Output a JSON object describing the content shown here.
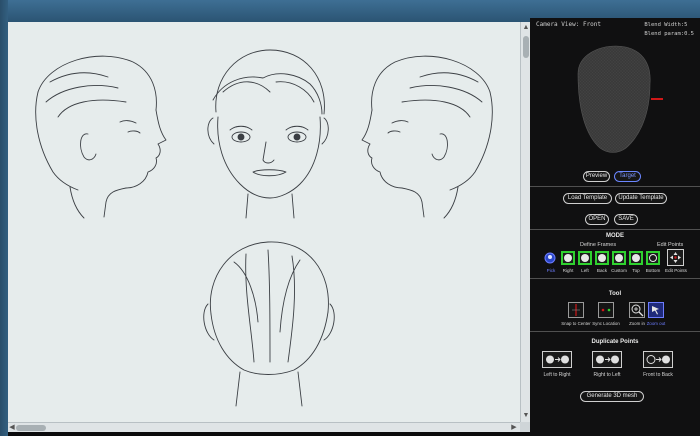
{
  "panel": {
    "camera_view": "Camera View: Front",
    "blend_width": "Blend Width:5",
    "blend_param": "Blend param:0.5",
    "preview_label": "Preview",
    "target_label": "Target",
    "load_template_label": "Load Template",
    "update_template_label": "Update Template",
    "open_label": "OPEN",
    "save_label": "SAVE",
    "mode_title": "MODE",
    "define_frames_label": "Define Frames",
    "edit_points_heading": "Edit Points",
    "mode_items": [
      {
        "label": "Pick",
        "icon": "pick-icon"
      },
      {
        "label": "Right",
        "icon": "head-right-icon"
      },
      {
        "label": "Left",
        "icon": "head-left-icon"
      },
      {
        "label": "Back",
        "icon": "head-back-icon"
      },
      {
        "label": "Custom",
        "icon": "head-custom-icon"
      },
      {
        "label": "Top",
        "icon": "head-top-icon"
      },
      {
        "label": "Bottom",
        "icon": "head-bottom-icon"
      },
      {
        "label": "Edit Points",
        "icon": "edit-points-icon"
      }
    ],
    "tool_title": "Tool",
    "tool_items": [
      {
        "label": "Snap to Center",
        "icon": "snap-to-center-icon"
      },
      {
        "label": "Sync Location",
        "icon": "sync-location-icon"
      },
      {
        "label": "Zoom in",
        "icon": "zoom-in-icon"
      },
      {
        "label": "Zoom out",
        "icon": "zoom-out-icon"
      }
    ],
    "duplicate_title": "Duplicate Points",
    "duplicate_items": [
      {
        "label": "Left to Right",
        "icon": "left-to-right-icon"
      },
      {
        "label": "Right to Left",
        "icon": "right-to-left-icon"
      },
      {
        "label": "Front to Back",
        "icon": "front-to-back-icon"
      }
    ],
    "generate_label": "Generate 3D mesh"
  },
  "colors": {
    "canvas_bg": "#e6ecec",
    "panel_bg": "#101011",
    "frame_green": "#2fd12f",
    "active_blue": "#6d7dff",
    "marker_red": "#d01818"
  }
}
